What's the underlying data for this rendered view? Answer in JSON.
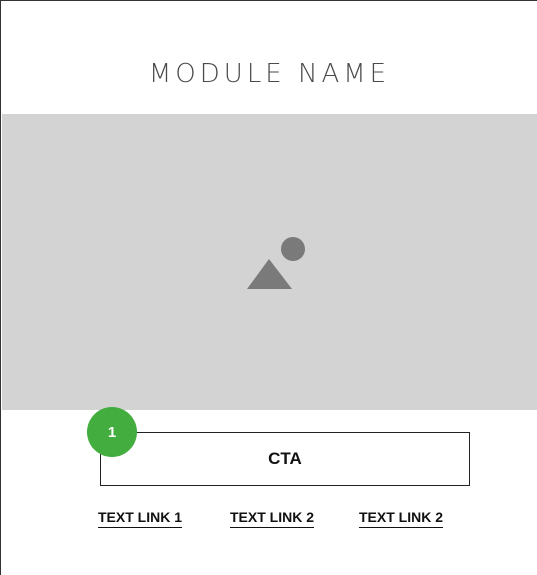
{
  "module": {
    "title": "MODULE NAME"
  },
  "image": {
    "icon": "image-placeholder-icon"
  },
  "badge": {
    "label": "1",
    "color": "#44ad3f"
  },
  "cta": {
    "label": "CTA"
  },
  "links": [
    {
      "label": "TEXT LINK 1"
    },
    {
      "label": "TEXT LINK 2"
    },
    {
      "label": "TEXT LINK 2"
    }
  ],
  "colors": {
    "placeholder_bg": "#d3d3d3",
    "icon": "#7a7a7a",
    "text": "#111111"
  }
}
